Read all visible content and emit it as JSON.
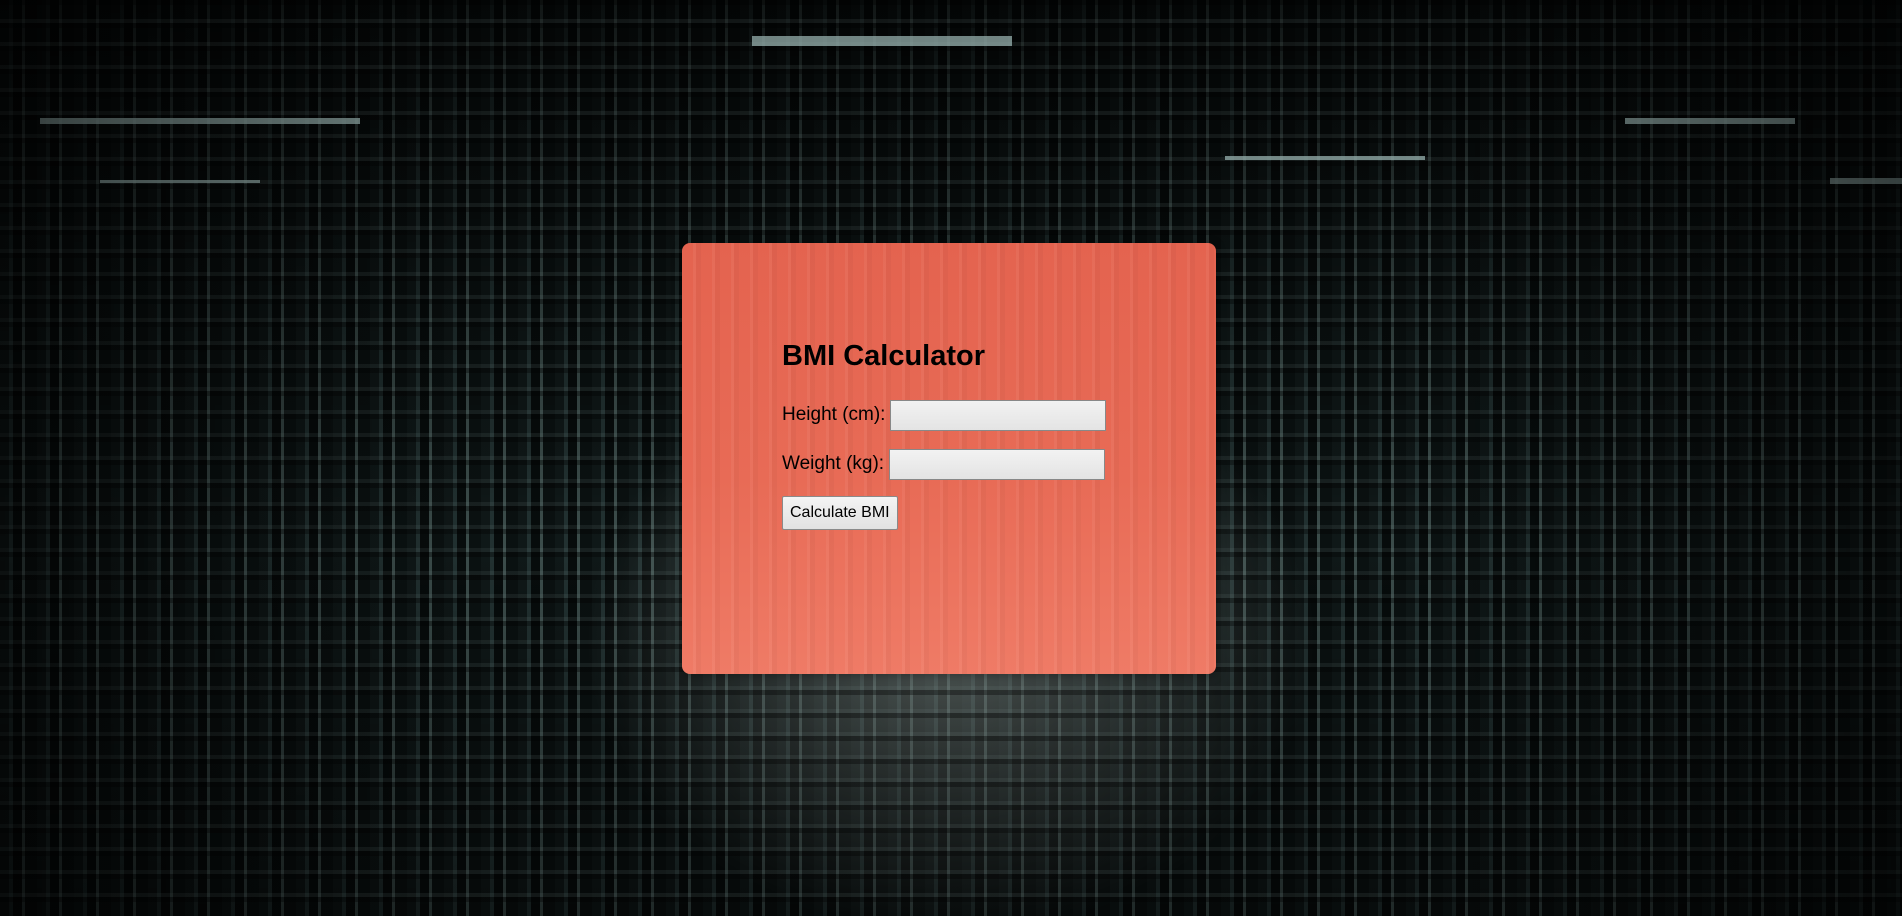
{
  "form": {
    "title": "BMI Calculator",
    "height_label": "Height (cm):",
    "height_value": "",
    "weight_label": "Weight (kg):",
    "weight_value": "",
    "submit_label": "Calculate BMI"
  },
  "colors": {
    "card_background": "#e86b56",
    "page_background": "#0b1313"
  }
}
